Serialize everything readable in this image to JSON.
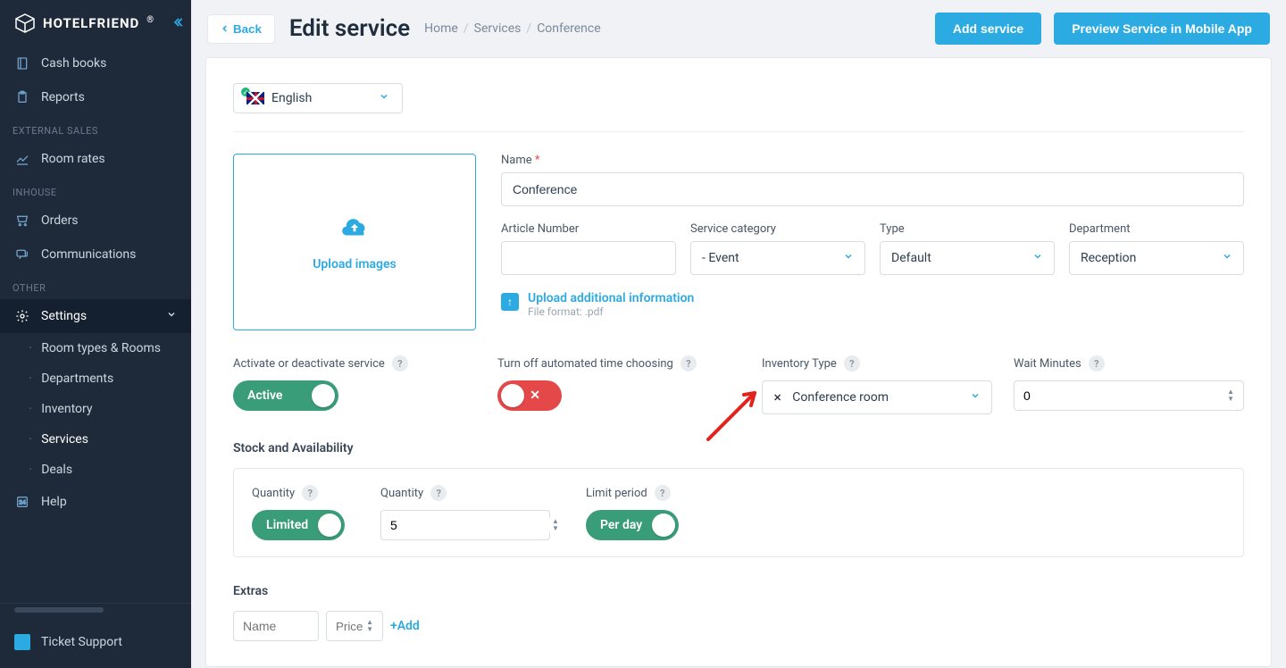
{
  "brand": "HOTELFRIEND",
  "sidebar": {
    "items_top": [
      {
        "label": "Cash books",
        "icon": "book-icon"
      },
      {
        "label": "Reports",
        "icon": "clipboard-icon"
      }
    ],
    "section_external": "EXTERNAL SALES",
    "items_ext": [
      {
        "label": "Room rates",
        "icon": "chart-icon"
      }
    ],
    "section_inhouse": "INHOUSE",
    "items_inhouse": [
      {
        "label": "Orders",
        "icon": "cart-icon"
      },
      {
        "label": "Communications",
        "icon": "chat-icon"
      }
    ],
    "section_other": "OTHER",
    "settings_label": "Settings",
    "sub_items": [
      "Room types & Rooms",
      "Departments",
      "Inventory",
      "Services",
      "Deals"
    ],
    "help_label": "Help",
    "ticket_label": "Ticket Support"
  },
  "topbar": {
    "back": "Back",
    "title": "Edit service",
    "breadcrumb": [
      "Home",
      "Services",
      "Conference"
    ],
    "add_service": "Add service",
    "preview": "Preview Service in Mobile App"
  },
  "form": {
    "language": "English",
    "upload_images": "Upload images",
    "name_label": "Name",
    "name_value": "Conference",
    "article_label": "Article Number",
    "article_value": "",
    "category_label": "Service category",
    "category_value": "- Event",
    "type_label": "Type",
    "type_value": "Default",
    "dept_label": "Department",
    "dept_value": "Reception",
    "upload_addl": "Upload additional information",
    "upload_hint": "File format: .pdf",
    "activate_label": "Activate or deactivate service",
    "activate_value": "Active",
    "turnoff_label": "Turn off automated time choosing",
    "inventory_label": "Inventory Type",
    "inventory_value": "Conference room",
    "wait_label": "Wait Minutes",
    "wait_value": "0",
    "stock_header": "Stock and Availability",
    "quantity_label": "Quantity",
    "quantity_toggle": "Limited",
    "quantity_value": "5",
    "limit_label": "Limit period",
    "limit_value": "Per day",
    "extras_header": "Extras",
    "extras_name_ph": "Name",
    "extras_price_ph": "Price",
    "add_label": "Add"
  }
}
